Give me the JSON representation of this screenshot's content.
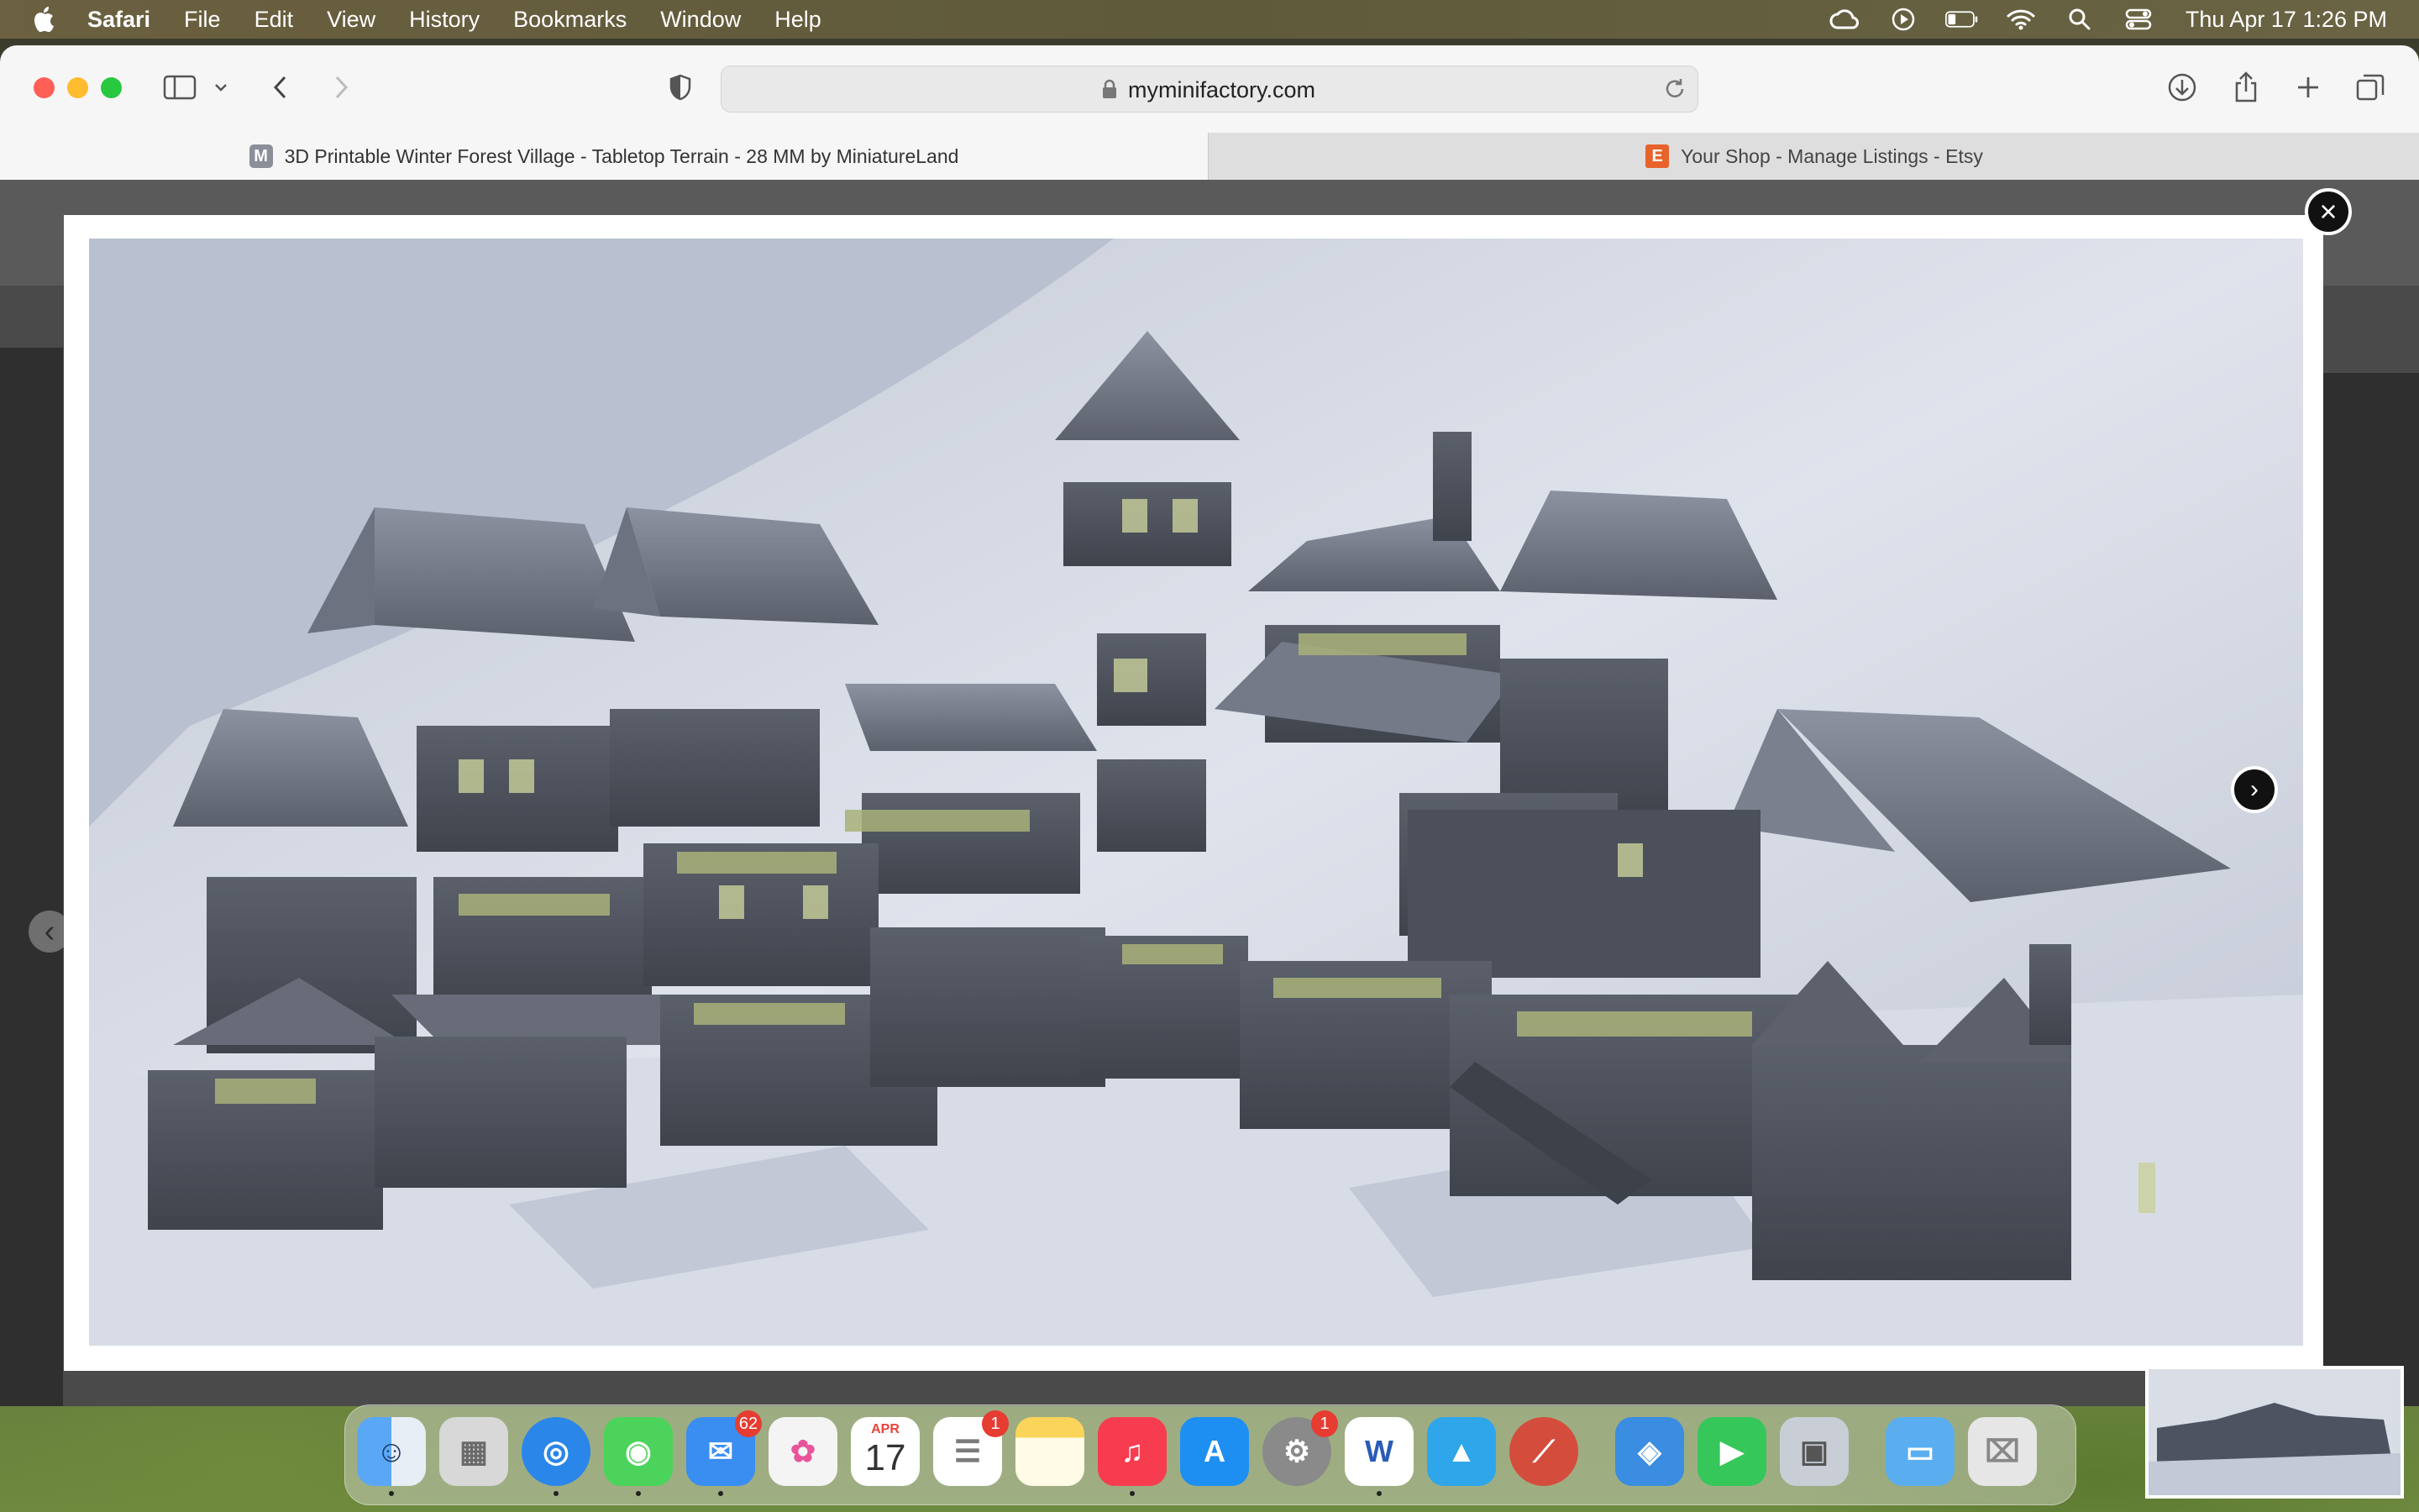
{
  "menubar": {
    "app": "Safari",
    "items": [
      "File",
      "Edit",
      "View",
      "History",
      "Bookmarks",
      "Window",
      "Help"
    ],
    "clock": "Thu Apr 17  1:26 PM"
  },
  "toolbar": {
    "url": "myminifactory.com"
  },
  "tabs": [
    {
      "favicon": "M",
      "title": "3D Printable Winter Forest Village - Tabletop Terrain - 28 MM by MiniatureLand",
      "favicon_color": "#8a8f99"
    },
    {
      "favicon": "E",
      "title": "Your Shop - Manage Listings - Etsy",
      "favicon_color": "#e8632b"
    }
  ],
  "lightbox": {
    "close_glyph": "×",
    "next_glyph": "›",
    "prev_glyph": "‹",
    "image_icon": "terrain-buildings-image"
  },
  "dock": {
    "apps": [
      {
        "name": "finder",
        "color": "#3b8df0",
        "glyph": "☺",
        "running": true
      },
      {
        "name": "launchpad",
        "color": "#d8d8d8",
        "glyph": "▦",
        "running": false
      },
      {
        "name": "safari",
        "color": "#2a86e8",
        "glyph": "◎",
        "running": true
      },
      {
        "name": "messages",
        "color": "#4cd35b",
        "glyph": "◉",
        "running": true
      },
      {
        "name": "mail",
        "color": "#3a8ef2",
        "glyph": "✉",
        "running": true,
        "badge": "62"
      },
      {
        "name": "photos",
        "color": "#f4f4f4",
        "glyph": "✿",
        "running": false
      },
      {
        "name": "calendar",
        "color": "#ffffff",
        "glyph": "17",
        "label_top": "APR",
        "running": false
      },
      {
        "name": "reminders",
        "color": "#ffffff",
        "glyph": "☰",
        "running": false,
        "badge": "1"
      },
      {
        "name": "notes",
        "color": "#fbd45a",
        "glyph": "▤",
        "running": false
      },
      {
        "name": "music",
        "color": "#f83c4f",
        "glyph": "♫",
        "running": true
      },
      {
        "name": "app-store",
        "color": "#1d8ff2",
        "glyph": "A",
        "running": false
      },
      {
        "name": "system-settings",
        "color": "#8a8a8a",
        "glyph": "⚙",
        "running": false,
        "badge": "1"
      },
      {
        "name": "word",
        "color": "#ffffff",
        "glyph": "W",
        "running": true
      },
      {
        "name": "affinity-designer",
        "color": "#2fa6ea",
        "glyph": "▲",
        "running": false
      },
      {
        "name": "vector-app",
        "color": "#d44c3c",
        "glyph": "⟋",
        "running": false
      },
      {
        "name": "sketchup-box",
        "color": "#3a8de0",
        "glyph": "◈",
        "running": false
      },
      {
        "name": "facetime",
        "color": "#35c759",
        "glyph": "▶",
        "running": false
      },
      {
        "name": "preview",
        "color": "#c9ced6",
        "glyph": "▣",
        "running": false
      },
      {
        "name": "folder",
        "color": "#5aaef0",
        "glyph": "▭",
        "running": false
      },
      {
        "name": "trash",
        "color": "#e6e6e6",
        "glyph": "🗑",
        "running": false
      }
    ]
  },
  "colors": {
    "menubar": "#625c3e",
    "toolbar": "#f6f6f6",
    "lightbox_bg": "#ffffff",
    "photo_bg": "#c9cfdb",
    "building": "#4d5360"
  }
}
